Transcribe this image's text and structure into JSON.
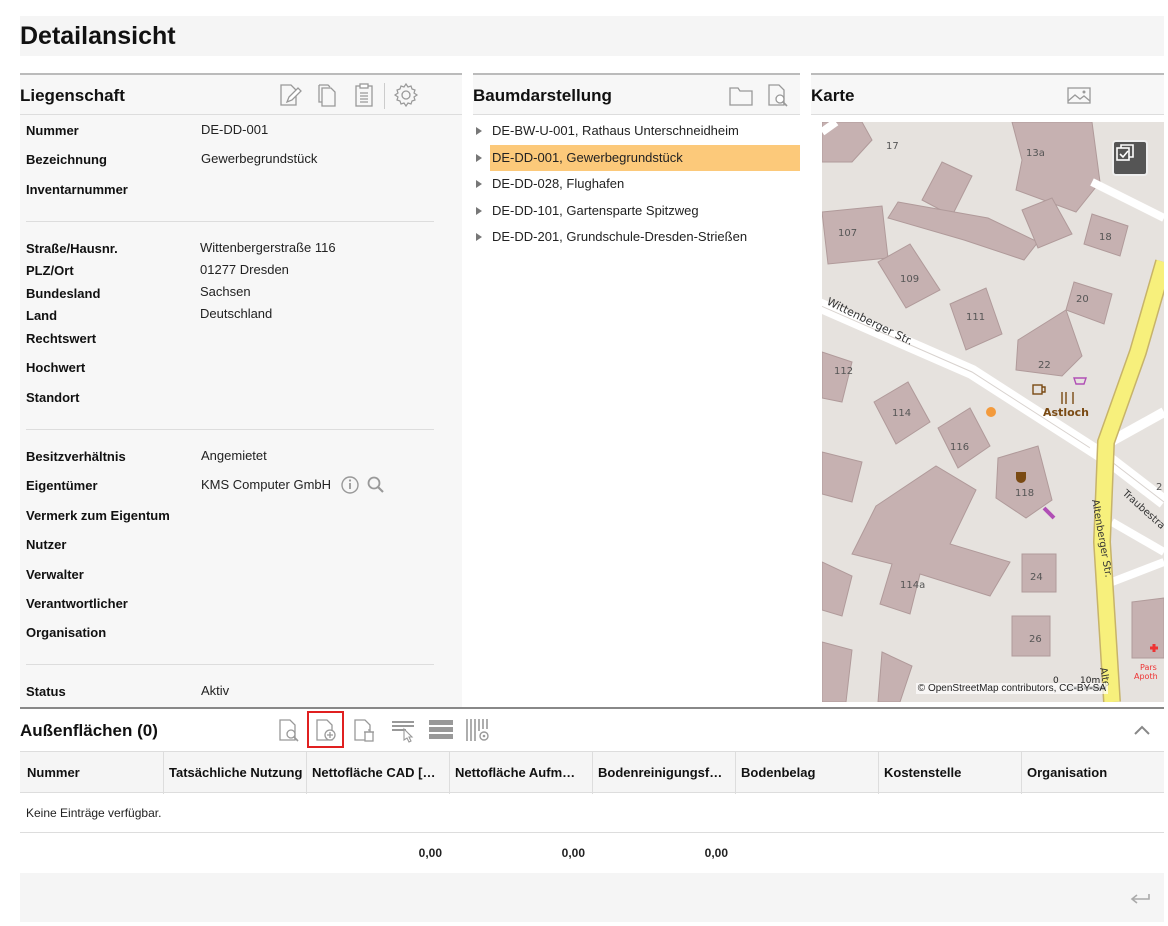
{
  "page": {
    "title": "Detailansicht"
  },
  "liegenschaft": {
    "title": "Liegenschaft",
    "fields": [
      {
        "label": "Nummer",
        "value": "DE-DD-001"
      },
      {
        "label": "Bezeichnung",
        "value": "Gewerbegrundstück"
      },
      {
        "label": "Inventarnummer",
        "value": ""
      },
      {
        "label": "Straße/Hausnr.",
        "value": "Wittenbergerstraße 116"
      },
      {
        "label": "PLZ/Ort",
        "value": "01277 Dresden"
      },
      {
        "label": "Bundesland",
        "value": "Sachsen"
      },
      {
        "label": "Land",
        "value": "Deutschland"
      },
      {
        "label": "Rechtswert",
        "value": ""
      },
      {
        "label": "Hochwert",
        "value": ""
      },
      {
        "label": "Standort",
        "value": ""
      },
      {
        "label": "Besitzverhältnis",
        "value": "Angemietet"
      },
      {
        "label": "Eigentümer",
        "value": "KMS Computer GmbH"
      },
      {
        "label": "Vermerk zum Eigentum",
        "value": ""
      },
      {
        "label": "Nutzer",
        "value": ""
      },
      {
        "label": "Verwalter",
        "value": ""
      },
      {
        "label": "Verantwortlicher",
        "value": ""
      },
      {
        "label": "Organisation",
        "value": ""
      },
      {
        "label": "Status",
        "value": "Aktiv"
      }
    ]
  },
  "baum": {
    "title": "Baumdarstellung",
    "items": [
      {
        "label": "DE-BW-U-001, Rathaus Unterschneidheim",
        "selected": false
      },
      {
        "label": "DE-DD-001, Gewerbegrundstück",
        "selected": true
      },
      {
        "label": "DE-DD-028, Flughafen",
        "selected": false
      },
      {
        "label": "DE-DD-101, Gartensparte Spitzweg",
        "selected": false
      },
      {
        "label": "DE-DD-201, Grundschule-Dresden-Strießen",
        "selected": false
      }
    ]
  },
  "karte": {
    "title": "Karte",
    "attribution": "© OpenStreetMap contributors, CC-BY-SA",
    "scale": "10m",
    "scale_zero": "0",
    "labels": {
      "street1": "Wittenberger Str.",
      "street2": "Altenberger Str.",
      "street3": "Traubestra",
      "street4": "Alte",
      "poi": "Astloch",
      "pharmacy1": "Pars",
      "pharmacy2": "Apoth",
      "h17": "17",
      "h13a": "13a",
      "h107": "107",
      "h18": "18",
      "h109": "109",
      "h20": "20",
      "h111": "111",
      "h22": "22",
      "h112": "112",
      "h114": "114",
      "h116": "116",
      "h118": "118",
      "h114a": "114a",
      "h24": "24",
      "h26": "26",
      "h2": "2"
    }
  },
  "aussen": {
    "title": "Außenflächen (0)",
    "columns": [
      "Nummer",
      "Tatsächliche Nutzung",
      "Nettofläche CAD […",
      "Nettofläche Aufm…",
      "Bodenreinigungsf…",
      "Bodenbelag",
      "Kostenstelle",
      "Organisation"
    ],
    "empty_text": "Keine Einträge verfügbar.",
    "sums": [
      "0,00",
      "0,00",
      "0,00"
    ]
  }
}
